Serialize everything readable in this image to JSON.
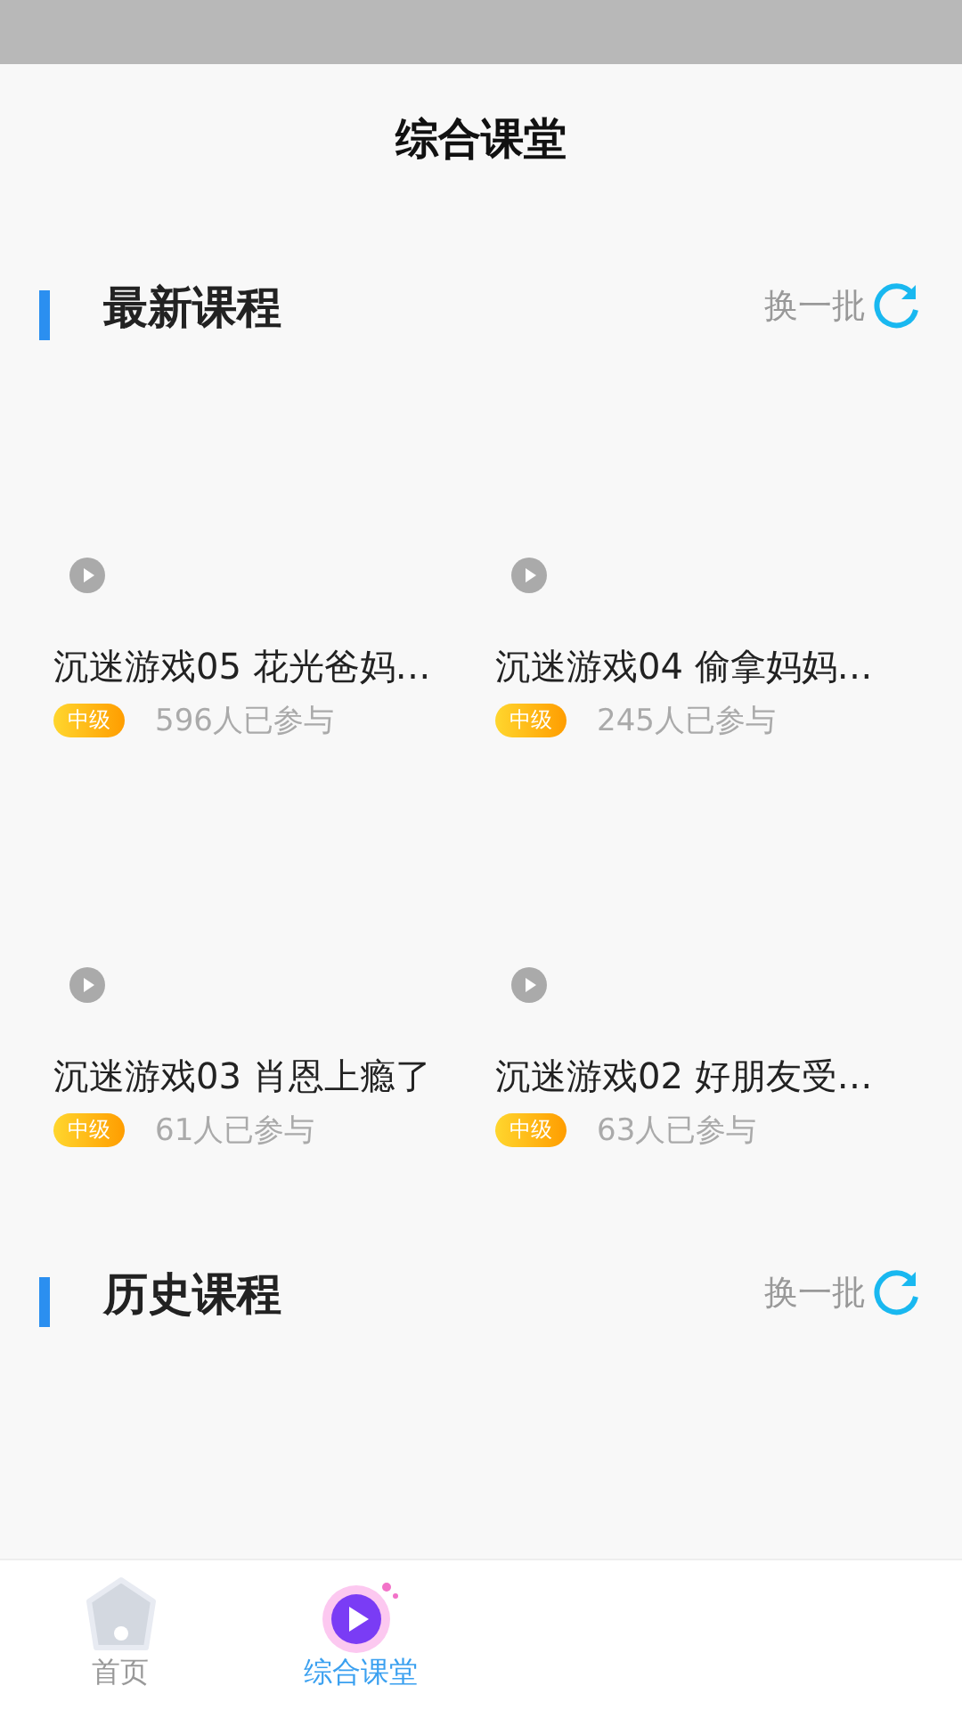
{
  "header": {
    "title": "综合课堂"
  },
  "sections": [
    {
      "title": "最新课程",
      "refresh": "换一批",
      "courses": [
        {
          "title": "沉迷游戏05 花光爸妈…",
          "level": "中级",
          "participants": "596人已参与"
        },
        {
          "title": "沉迷游戏04 偷拿妈妈…",
          "level": "中级",
          "participants": "245人已参与"
        },
        {
          "title": "沉迷游戏03 肖恩上瘾了",
          "level": "中级",
          "participants": "61人已参与"
        },
        {
          "title": "沉迷游戏02 好朋友受…",
          "level": "中级",
          "participants": "63人已参与"
        }
      ]
    },
    {
      "title": "历史课程",
      "refresh": "换一批"
    }
  ],
  "tabs": [
    {
      "label": "首页",
      "kind": "home",
      "selected": false
    },
    {
      "label": "综合课堂",
      "kind": "class",
      "selected": true
    }
  ]
}
